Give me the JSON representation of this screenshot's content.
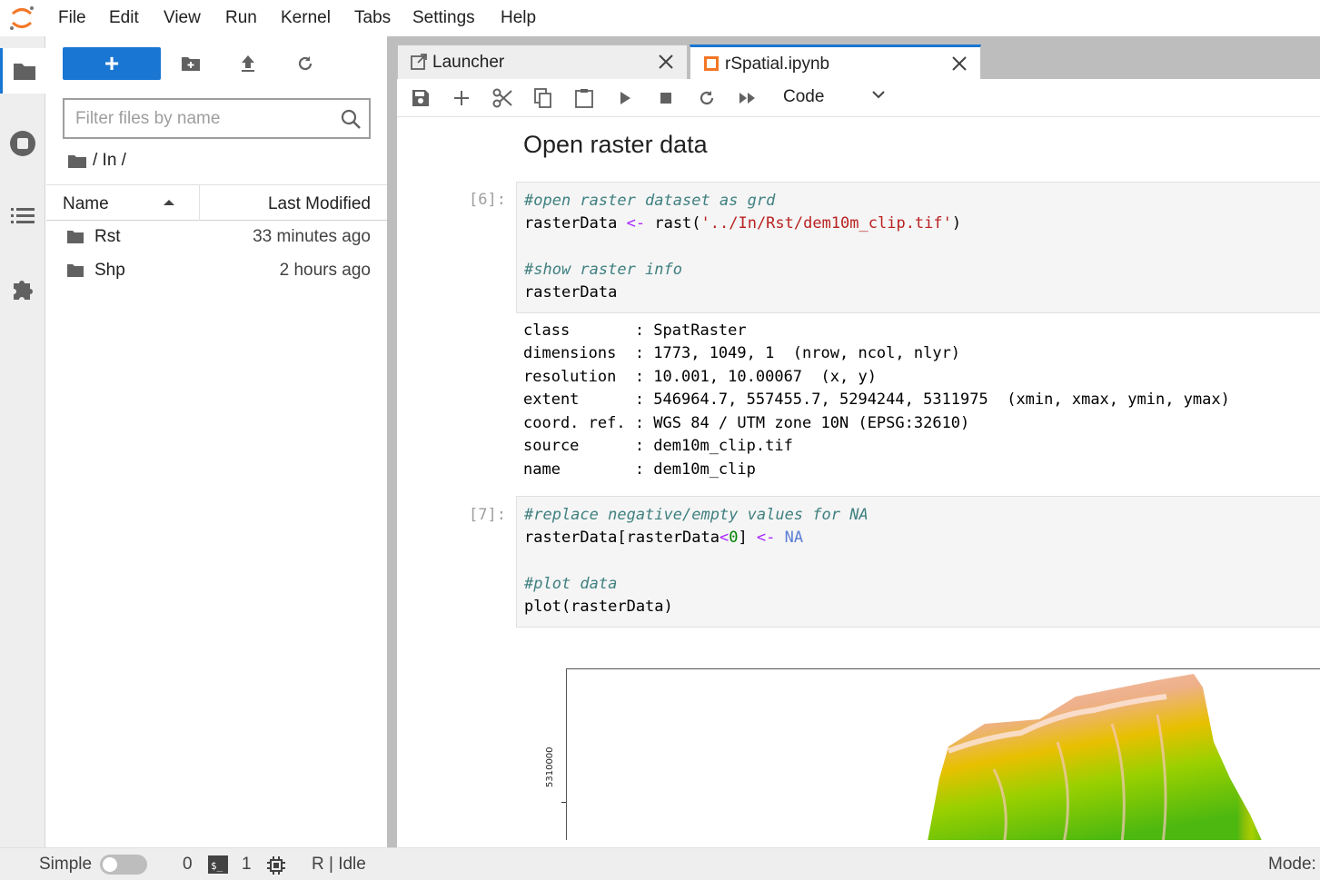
{
  "menubar": {
    "items": [
      "File",
      "Edit",
      "View",
      "Run",
      "Kernel",
      "Tabs",
      "Settings",
      "Help"
    ]
  },
  "filebrowser": {
    "new_button_label": "+",
    "filter_placeholder": "Filter files by name",
    "breadcrumb": "/ In /",
    "columns": {
      "name": "Name",
      "modified": "Last Modified"
    },
    "files": [
      {
        "name": "Rst",
        "modified": "33 minutes ago"
      },
      {
        "name": "Shp",
        "modified": "2 hours ago"
      }
    ]
  },
  "tabs": [
    {
      "label": "Launcher"
    },
    {
      "label": "rSpatial.ipynb"
    }
  ],
  "toolbar": {
    "cell_type": "Code"
  },
  "notebook": {
    "heading": "Open raster data",
    "cell1": {
      "prompt": "[6]:",
      "comment1": "#open raster dataset as grd",
      "var": "rasterData",
      "assign": "<-",
      "fn_open": "rast(",
      "path": "'../In/Rst/dem10m_clip.tif'",
      "fn_close": ")",
      "comment2": "#show raster info",
      "line4": "rasterData"
    },
    "output": [
      "class       : SpatRaster",
      "dimensions  : 1773, 1049, 1  (nrow, ncol, nlyr)",
      "resolution  : 10.001, 10.00067  (x, y)",
      "extent      : 546964.7, 557455.7, 5294244, 5311975  (xmin, xmax, ymin, ymax)",
      "coord. ref. : WGS 84 / UTM zone 10N (EPSG:32610)",
      "source      : dem10m_clip.tif",
      "name        : dem10m_clip"
    ],
    "cell2": {
      "prompt": "[7]:",
      "comment1": "#replace negative/empty values for NA",
      "part1": "rasterData[rasterData",
      "lt": "<",
      "zero": "0",
      "part2": "] ",
      "assign": "<-",
      "na": "NA",
      "comment2": "#plot data",
      "line4": "plot(rasterData)"
    },
    "plot": {
      "y_tick_label": "5310000"
    }
  },
  "statusbar": {
    "mode_label": "Simple",
    "terminals": "0",
    "kernels": "1",
    "kernel_status": "R | Idle",
    "mode": "Mode:"
  },
  "colors": {
    "accent": "#1976d2",
    "raster_high": "#f2b8a8",
    "raster_mid": "#e8c000",
    "raster_low": "#5cbf10"
  }
}
